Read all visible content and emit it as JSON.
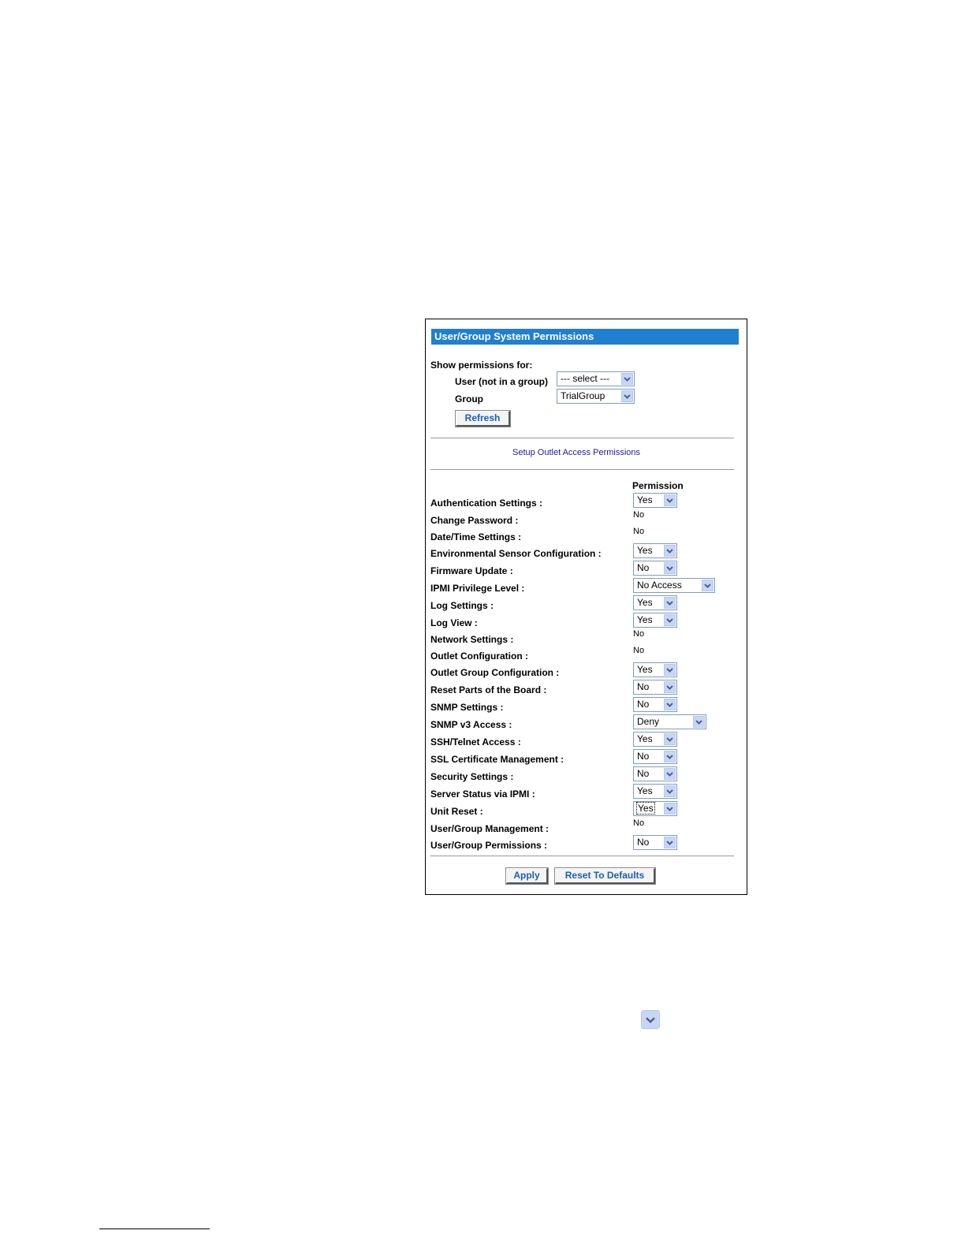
{
  "panel": {
    "title": "User/Group System Permissions",
    "show_for_label": "Show permissions for:",
    "user_label": "User (not in a group)",
    "user_select_value": "--- select ---",
    "group_label": "Group",
    "group_select_value": "TrialGroup",
    "refresh_label": "Refresh",
    "outlet_link": "Setup Outlet Access Permissions",
    "permission_header": "Permission",
    "apply_label": "Apply",
    "reset_label": "Reset To Defaults"
  },
  "permissions": [
    {
      "label": "Authentication Settings :",
      "value": "Yes",
      "control": "select"
    },
    {
      "label": "Change Password :",
      "value": "No",
      "control": "text"
    },
    {
      "label": "Date/Time Settings :",
      "value": "No",
      "control": "text"
    },
    {
      "label": "Environmental Sensor Configuration :",
      "value": "Yes",
      "control": "select"
    },
    {
      "label": "Firmware Update :",
      "value": "No",
      "control": "select"
    },
    {
      "label": "IPMI Privilege Level :",
      "value": "No Access",
      "control": "select"
    },
    {
      "label": "Log Settings :",
      "value": "Yes",
      "control": "select"
    },
    {
      "label": "Log View :",
      "value": "Yes",
      "control": "select"
    },
    {
      "label": "Network Settings :",
      "value": "No",
      "control": "text"
    },
    {
      "label": "Outlet Configuration :",
      "value": "No",
      "control": "text"
    },
    {
      "label": "Outlet Group Configuration :",
      "value": "Yes",
      "control": "select"
    },
    {
      "label": "Reset Parts of the Board :",
      "value": "No",
      "control": "select"
    },
    {
      "label": "SNMP Settings :",
      "value": "No",
      "control": "select"
    },
    {
      "label": "SNMP v3 Access :",
      "value": "Deny",
      "control": "select"
    },
    {
      "label": "SSH/Telnet Access :",
      "value": "Yes",
      "control": "select"
    },
    {
      "label": "SSL Certificate Management :",
      "value": "No",
      "control": "select"
    },
    {
      "label": "Security Settings :",
      "value": "No",
      "control": "select"
    },
    {
      "label": "Server Status via IPMI :",
      "value": "Yes",
      "control": "select"
    },
    {
      "label": "Unit Reset :",
      "value": "Yes",
      "control": "select"
    },
    {
      "label": "User/Group Management :",
      "value": "No",
      "control": "text"
    },
    {
      "label": "User/Group Permissions :",
      "value": "No",
      "control": "select"
    }
  ],
  "colors": {
    "title_bar": "#1f7fd0",
    "button_text": "#1a5fb4",
    "link_text": "#1a1aa6",
    "dropdown_arrow_bg": "#c6d6f7"
  },
  "icons": {
    "dropdown_arrow": "chevron-down-icon"
  }
}
